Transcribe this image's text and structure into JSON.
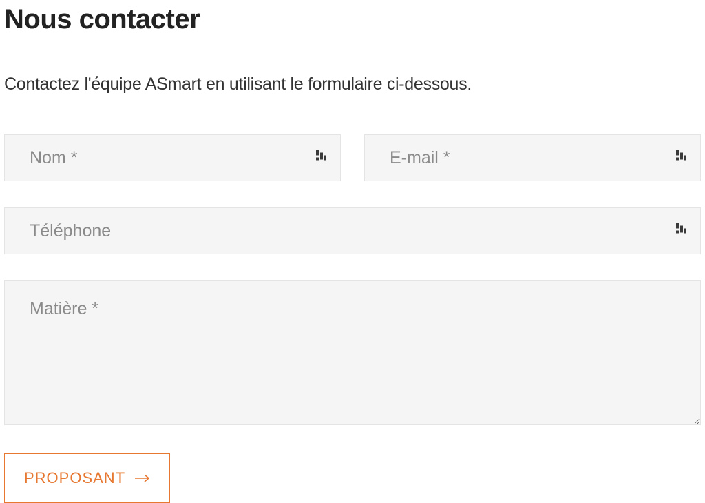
{
  "heading": "Nous contacter",
  "subheading": "Contactez l'équipe ASmart en utilisant le formulaire ci-dessous.",
  "form": {
    "name": {
      "placeholder": "Nom *",
      "value": ""
    },
    "email": {
      "placeholder": "E-mail *",
      "value": ""
    },
    "phone": {
      "placeholder": "Téléphone",
      "value": ""
    },
    "subject": {
      "placeholder": "Matière *",
      "value": ""
    }
  },
  "submit": {
    "label": "PROPOSANT"
  },
  "colors": {
    "accent": "#e77831"
  }
}
